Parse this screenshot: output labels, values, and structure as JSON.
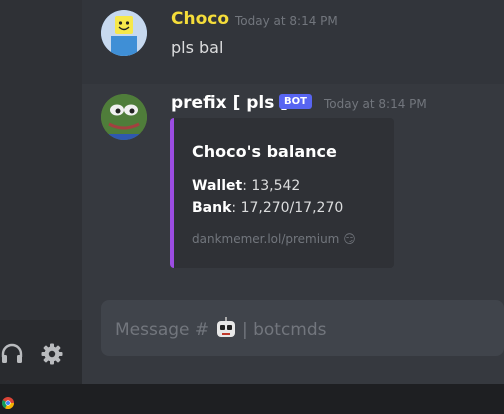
{
  "messages": [
    {
      "username": "Choco",
      "username_color": "#f5dd3a",
      "timestamp": "Today at 8:14 PM",
      "text": "pls bal",
      "avatar": "roblox-noob-avatar"
    },
    {
      "username": "prefix [ pls ]",
      "username_color": "#ffffff",
      "bot_tag": "BOT",
      "timestamp": "Today at 8:14 PM",
      "avatar": "pepe-frog-avatar",
      "embed": {
        "title": "Choco's balance",
        "wallet_label": "Wallet",
        "wallet_value": ": 13,542",
        "bank_label": "Bank",
        "bank_value": ": 17,270/17,270",
        "footer": "dankmemer.lol/premium",
        "footer_emoji": "😏",
        "accent_color": "#9c4de2"
      }
    }
  ],
  "input": {
    "placeholder_prefix": "Message #",
    "channel": "| botcmds"
  },
  "user_panel": {
    "icons": [
      "headphones-icon",
      "settings-gear-icon"
    ]
  },
  "taskbar": {
    "icons": [
      "chrome-icon"
    ]
  }
}
